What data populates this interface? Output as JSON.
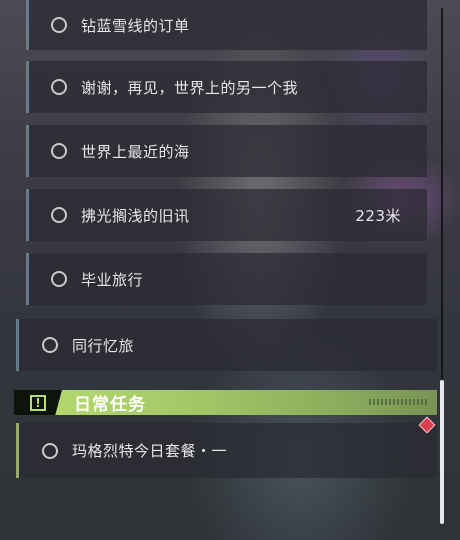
{
  "quests": [
    {
      "label": "钻蓝雪线的订单",
      "distance": ""
    },
    {
      "label": "谢谢，再见，世界上的另一个我",
      "distance": ""
    },
    {
      "label": "世界上最近的海",
      "distance": ""
    },
    {
      "label": "拂光搁浅的旧讯",
      "distance": "223米"
    },
    {
      "label": "毕业旅行",
      "distance": ""
    }
  ],
  "main_quest": {
    "label": "同行忆旅"
  },
  "daily_section": {
    "title": "日常任务",
    "icon": "exclamation-box-icon",
    "color": "#b7dc6f",
    "items": [
      {
        "label": "玛格烈特今日套餐・一"
      }
    ]
  },
  "tracking_marker": {
    "icon": "diamond-marker-icon",
    "color": "#d9404f"
  }
}
